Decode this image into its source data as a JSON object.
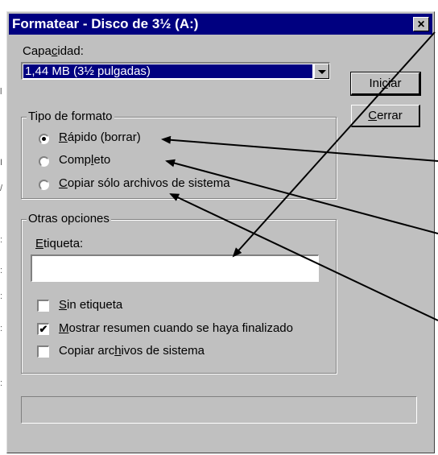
{
  "window": {
    "title": "Formatear - Disco de 3½ (A:)",
    "close_glyph": "×"
  },
  "capacity": {
    "label_pre": "Capa",
    "label_u": "c",
    "label_post": "idad:",
    "selected": "1,44 MB (3½ pulgadas)"
  },
  "buttons": {
    "start_pre": "Ini",
    "start_u": "c",
    "start_post": "iar",
    "close_u": "C",
    "close_post": "errar"
  },
  "format_type": {
    "title": "Tipo de formato",
    "options": [
      {
        "u": "R",
        "rest": "ápido (borrar)",
        "selected": true
      },
      {
        "pre": "Comp",
        "u": "l",
        "rest": "eto",
        "selected": false
      },
      {
        "u": "C",
        "rest": "opiar sólo archivos de sistema",
        "selected": false
      }
    ]
  },
  "other_options": {
    "title": "Otras opciones",
    "label_u": "E",
    "label_rest": "tiqueta:",
    "label_value": "",
    "checks": [
      {
        "u": "S",
        "rest": "in etiqueta",
        "checked": false
      },
      {
        "u": "M",
        "rest": "ostrar resumen cuando se haya finalizado",
        "checked": true
      },
      {
        "pre": "Copiar arc",
        "u": "h",
        "rest": "ivos de sistema",
        "checked": false
      }
    ]
  },
  "check_glyph": "✔"
}
